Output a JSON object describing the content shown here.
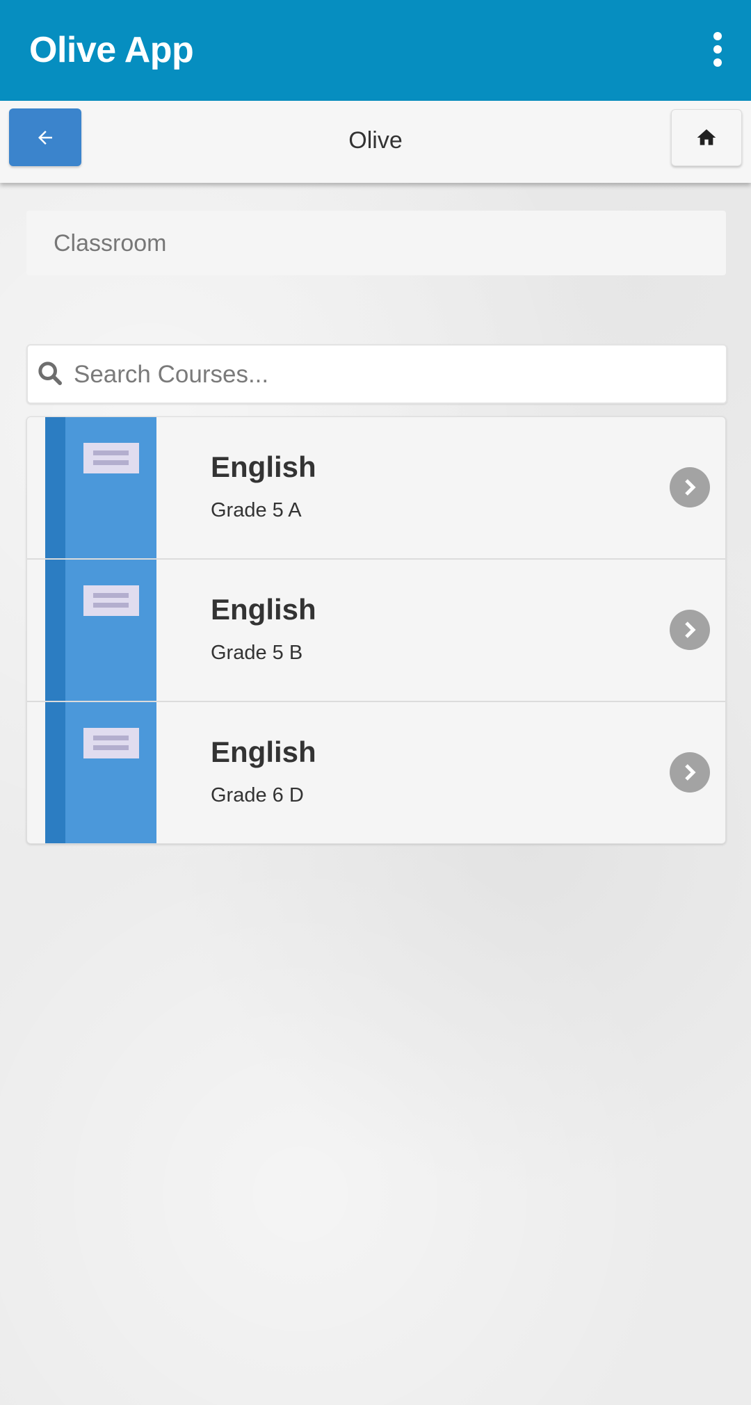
{
  "app_bar": {
    "title": "Olive App",
    "menu_icon": "more-vert-icon",
    "color": "#068ec0"
  },
  "sub_nav": {
    "title": "Olive",
    "back_icon": "arrow-left-icon",
    "home_icon": "home-icon"
  },
  "section": {
    "title": "Classroom"
  },
  "search": {
    "placeholder": "Search Courses...",
    "value": "",
    "icon": "search-icon"
  },
  "courses": [
    {
      "title": "English",
      "subtitle": "Grade 5 A",
      "icon": "book-icon",
      "action_icon": "chevron-right-icon"
    },
    {
      "title": "English",
      "subtitle": "Grade 5 B",
      "icon": "book-icon",
      "action_icon": "chevron-right-icon"
    },
    {
      "title": "English",
      "subtitle": "Grade 6 D",
      "icon": "book-icon",
      "action_icon": "chevron-right-icon"
    }
  ]
}
